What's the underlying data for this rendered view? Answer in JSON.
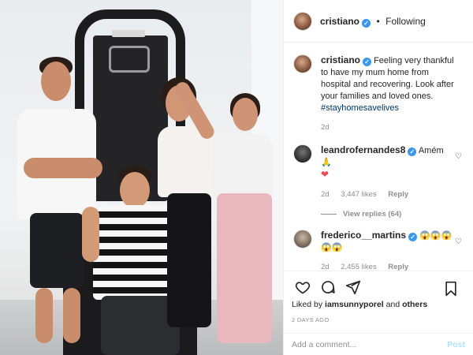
{
  "post": {
    "author": "cristiano",
    "follow_separator": "•",
    "follow_status": "Following",
    "caption": "Feeling very thankful to have my mum home from hospital and recovering. Look after your families and loved ones.",
    "hashtag": "#stayhomesavelives",
    "caption_age": "2d"
  },
  "comments": [
    {
      "user": "leandrofernandes8",
      "text": "Amém",
      "emoji": "🙏",
      "extra": "❤",
      "age": "2d",
      "likes": "3,447 likes",
      "reply": "Reply",
      "view_replies": "View replies (64)"
    },
    {
      "user": "frederico__martins",
      "emoji_line1": "😱😱😱",
      "emoji_line2": "😱😱",
      "age": "2d",
      "likes": "2,455 likes",
      "reply": "Reply"
    }
  ],
  "footer": {
    "liked_by_prefix": "Liked by",
    "liked_by_user": "iamsunnyporel",
    "liked_by_and": "and",
    "liked_by_others": "others",
    "date": "2 DAYS AGO",
    "comment_placeholder": "Add a comment...",
    "post_label": "Post"
  },
  "icons": {
    "like": "heart-icon",
    "comment": "comment-icon",
    "share": "share-icon",
    "save": "bookmark-icon",
    "verified": "verified-badge-icon"
  },
  "colors": {
    "verified": "#3897f0",
    "link": "#00376b",
    "muted": "#8e8e8e",
    "post_button": "#b2dffc"
  }
}
